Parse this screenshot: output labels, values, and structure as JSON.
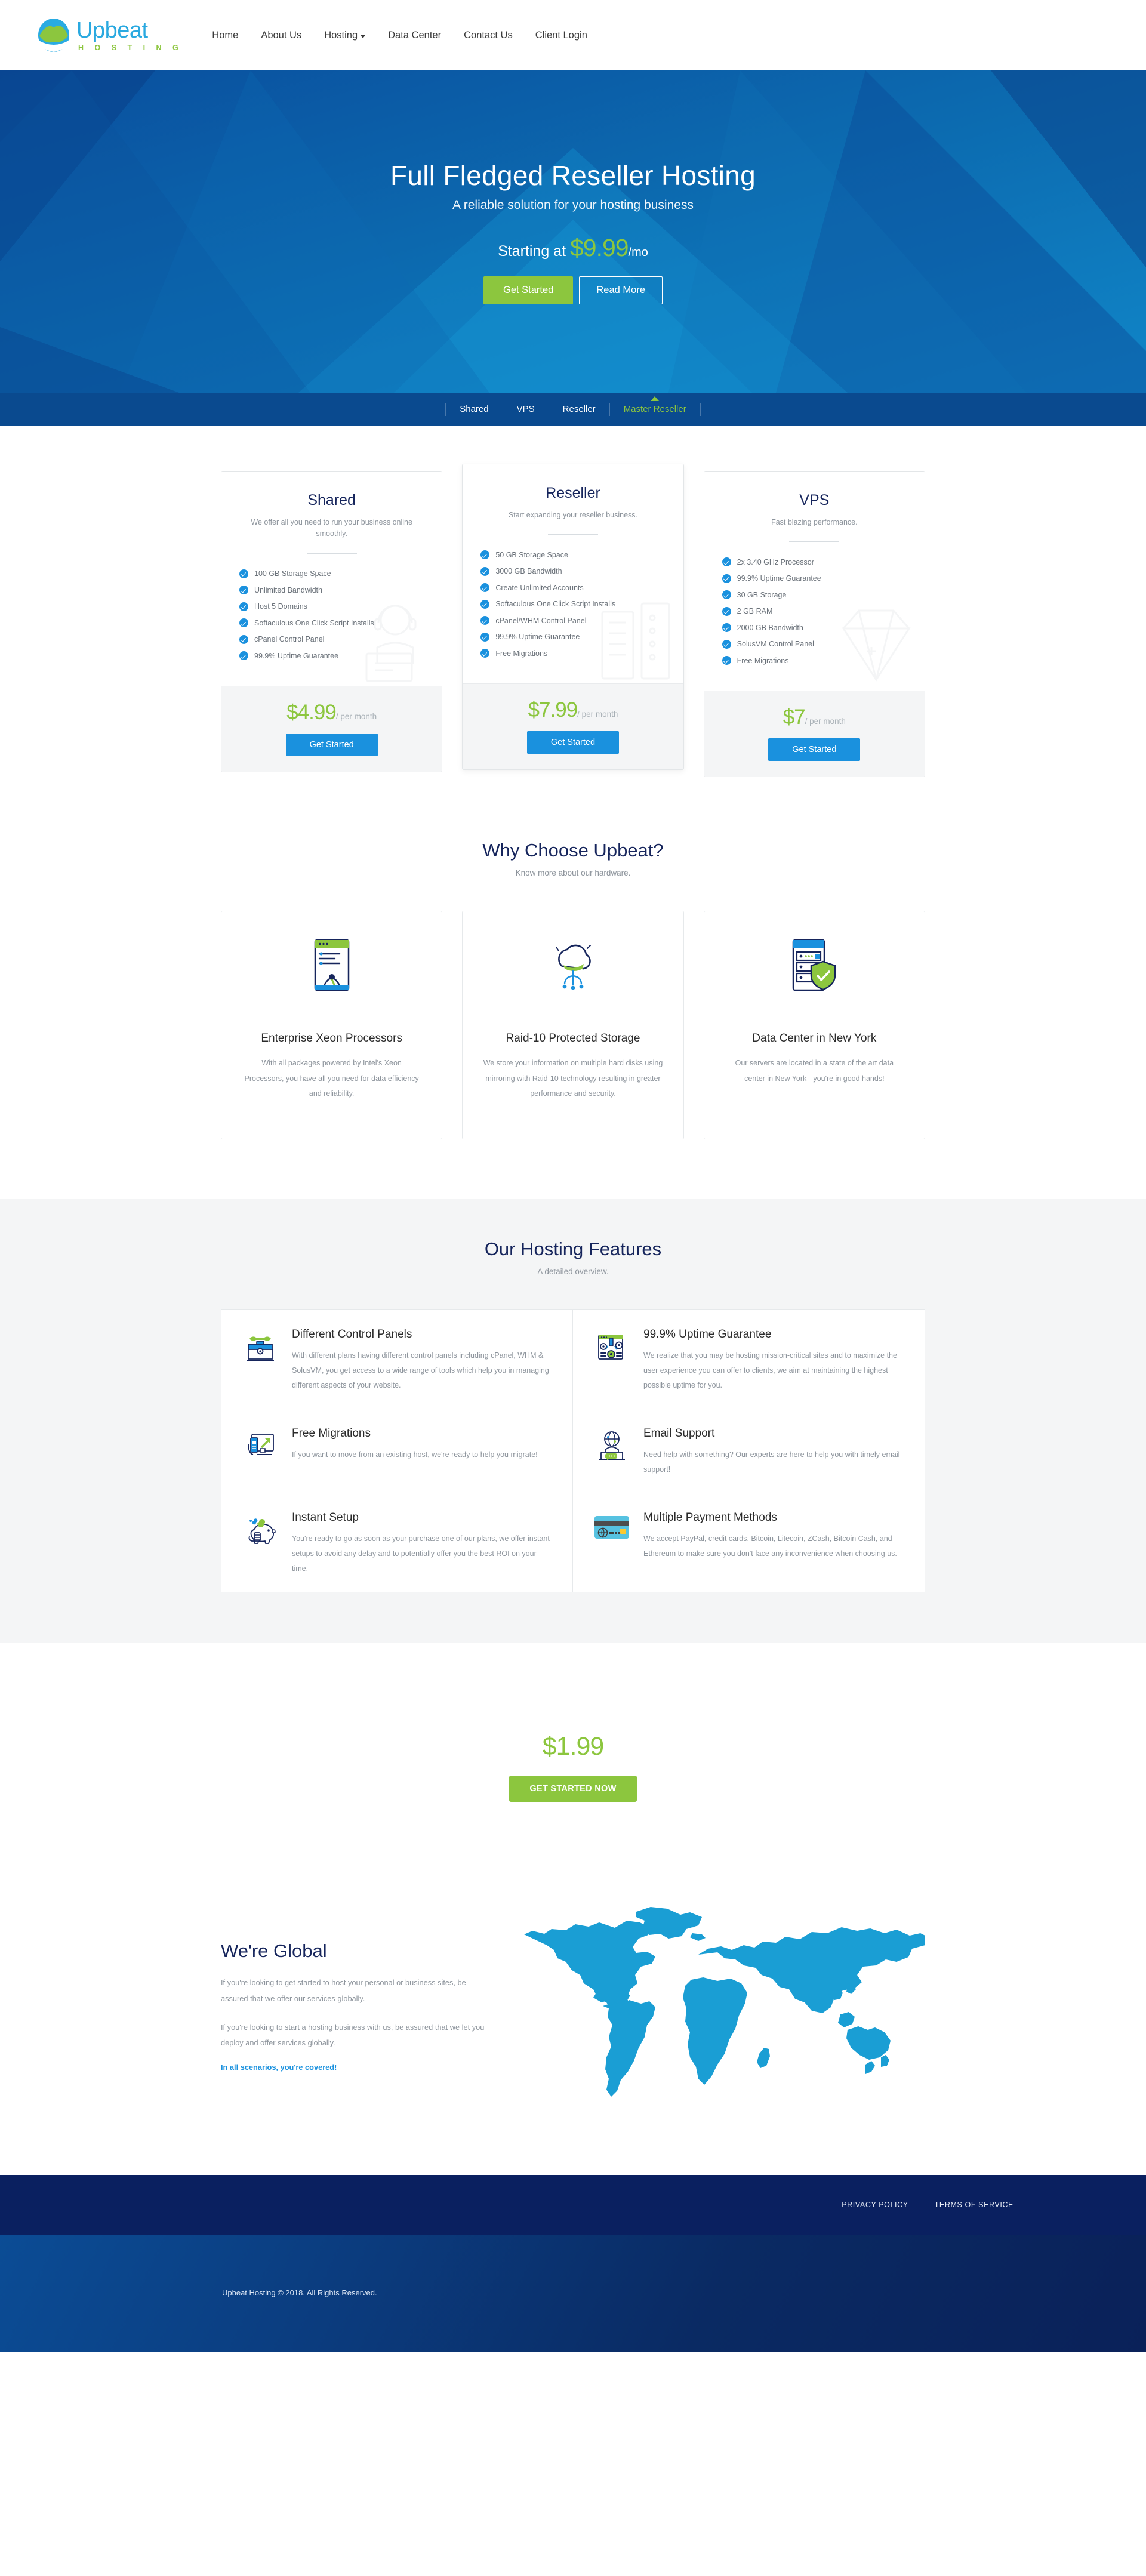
{
  "brand": {
    "word": "Upbeat",
    "sub": "H O S T I N G"
  },
  "nav": {
    "items": [
      {
        "label": "Home",
        "caret": false
      },
      {
        "label": "About Us",
        "caret": false
      },
      {
        "label": "Hosting",
        "caret": true
      },
      {
        "label": "Data Center",
        "caret": false
      },
      {
        "label": "Contact Us",
        "caret": false
      },
      {
        "label": "Client Login",
        "caret": false
      }
    ]
  },
  "hero": {
    "title": "Full Fledged Reseller Hosting",
    "subtitle": "A reliable solution for your hosting business",
    "price_prefix": "Starting at",
    "price": "$9.99",
    "price_suffix": "/mo",
    "cta_primary": "Get Started",
    "cta_secondary": "Read More"
  },
  "tabs": [
    {
      "label": "Shared",
      "active": false
    },
    {
      "label": "VPS",
      "active": false
    },
    {
      "label": "Reseller",
      "active": false
    },
    {
      "label": "Master Reseller",
      "active": true
    }
  ],
  "plans": [
    {
      "name": "Shared",
      "desc": "We offer all you need to run your business online smoothly.",
      "features": [
        "100 GB Storage Space",
        "Unlimited Bandwidth",
        "Host 5 Domains",
        "Softaculous One Click Script Installs",
        "cPanel Control Panel",
        "99.9% Uptime Guarantee"
      ],
      "price": "$4.99",
      "price_per": "/ per month",
      "cta": "Get Started"
    },
    {
      "name": "Reseller",
      "desc": "Start expanding your reseller business.",
      "features": [
        "50 GB Storage Space",
        "3000 GB Bandwidth",
        "Create Unlimited Accounts",
        "Softaculous One Click Script Installs",
        "cPanel/WHM Control Panel",
        "99.9% Uptime Guarantee",
        "Free Migrations"
      ],
      "price": "$7.99",
      "price_per": "/ per month",
      "cta": "Get Started"
    },
    {
      "name": "VPS",
      "desc": "Fast blazing performance.",
      "features": [
        "2x 3.40 GHz Processor",
        "99.9% Uptime Guarantee",
        "30 GB Storage",
        "2 GB RAM",
        "2000 GB Bandwidth",
        "SolusVM Control Panel",
        "Free Migrations"
      ],
      "price": "$7",
      "price_per": "/ per month",
      "cta": "Get Started"
    }
  ],
  "why": {
    "title": "Why Choose Upbeat?",
    "subtitle": "Know more about our hardware.",
    "cards": [
      {
        "icon": "cpu-monitor-icon",
        "title": "Enterprise Xeon Processors",
        "text": "With all packages powered by Intel's Xeon Processors, you have all you need for data efficiency and reliability."
      },
      {
        "icon": "cloud-storage-icon",
        "title": "Raid-10 Protected Storage",
        "text": "We store your information on multiple hard disks using mirroring with Raid-10 technology resulting in greater performance and security."
      },
      {
        "icon": "server-shield-icon",
        "title": "Data Center in New York",
        "text": "Our servers are located in a state of the art data center in New York - you're in good hands!"
      }
    ]
  },
  "features": {
    "title": "Our Hosting Features",
    "subtitle": "A detailed overview.",
    "items": [
      {
        "icon": "toolbox-icon",
        "title": "Different Control Panels",
        "text": "With different plans having different control panels including cPanel, WHM & SolusVM, you get access to a wide range of tools which help you in managing different aspects of your website."
      },
      {
        "icon": "uptime-gears-icon",
        "title": "99.9% Uptime Guarantee",
        "text": "We realize that you may be hosting mission-critical sites and to maximize the user experience you can offer to clients, we aim at maintaining the highest possible uptime for you."
      },
      {
        "icon": "migration-screen-icon",
        "title": "Free Migrations",
        "text": "If you want to move from an existing host, we're ready to help you migrate!"
      },
      {
        "icon": "email-support-icon",
        "title": "Email Support",
        "text": "Need help with something? Our experts are here to help you with timely email support!"
      },
      {
        "icon": "piggy-bank-icon",
        "title": "Instant Setup",
        "text": "You're ready to go as soon as your purchase one of our plans, we offer instant setups to avoid any delay and to potentially offer you the best ROI on your time."
      },
      {
        "icon": "credit-card-icon",
        "title": "Multiple Payment Methods",
        "text": "We accept PayPal, credit cards, Bitcoin, Litecoin, ZCash, Bitcoin Cash, and Ethereum to make sure you don't face any inconvenience when choosing us."
      }
    ]
  },
  "cta": {
    "price": "$1.99",
    "button": "GET STARTED NOW"
  },
  "global": {
    "title": "We're Global",
    "p1": "If you're looking to get started to host your personal or business sites, be assured that we offer our services globally.",
    "p2": "If you're looking to start a hosting business with us, be assured that we let you deploy and offer services globally.",
    "link": "In all scenarios, you're covered!",
    "map_icon": "world-map-icon"
  },
  "footer": {
    "links": [
      "PRIVACY POLICY",
      "TERMS OF SERVICE"
    ],
    "copyright": "Upbeat Hosting © 2018. All Rights Reserved."
  },
  "colors": {
    "brand_blue": "#2aa9e0",
    "brand_green": "#8cc63e",
    "accent_blue": "#1a91de",
    "navy": "#16255c",
    "footer_navy": "#0a2060",
    "tabstrip": "#0a4a8f"
  }
}
